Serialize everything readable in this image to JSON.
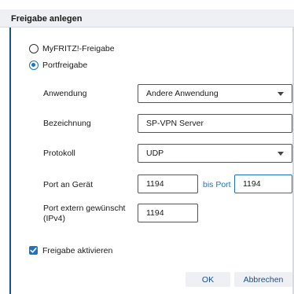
{
  "dialog": {
    "title": "Freigabe anlegen",
    "options": [
      {
        "label": "MyFRITZ!-Freigabe",
        "selected": false
      },
      {
        "label": "Portfreigabe",
        "selected": true
      }
    ],
    "fields": {
      "anwendung": {
        "label": "Anwendung",
        "value": "Andere Anwendung"
      },
      "bezeichnung": {
        "label": "Bezeichnung",
        "value": "SP-VPN Server"
      },
      "protokoll": {
        "label": "Protokoll",
        "value": "UDP"
      },
      "port_geraet": {
        "label": "Port an Gerät",
        "value": "1194",
        "to_label": "bis Port",
        "to_value": "1194"
      },
      "port_extern": {
        "label_line1": "Port extern gewünscht",
        "label_line2": "(IPv4)",
        "value": "1194"
      }
    },
    "activate": {
      "label": "Freigabe aktivieren",
      "checked": true
    },
    "buttons": {
      "ok": "OK",
      "cancel": "Abbrechen"
    }
  }
}
